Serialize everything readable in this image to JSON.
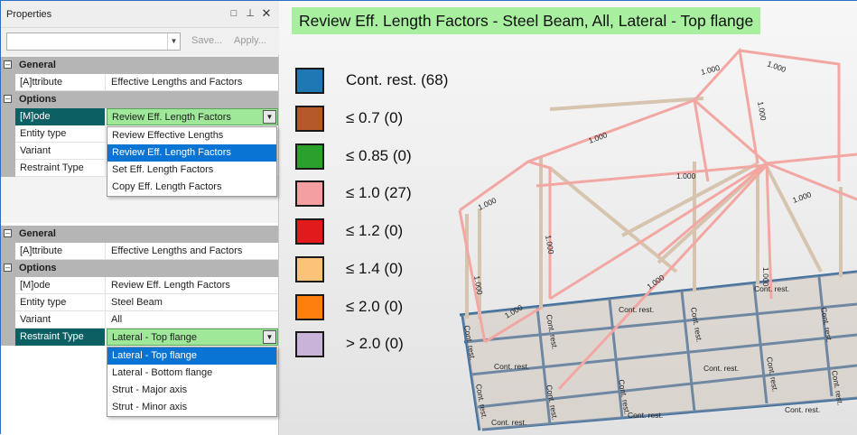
{
  "properties_top": {
    "title": "Properties",
    "toolbar": {
      "save_label": "Save...",
      "apply_label": "Apply..."
    },
    "categories": {
      "general": "General",
      "options": "Options"
    },
    "rows": [
      {
        "name": "[A]ttribute",
        "value": "Effective Lengths and Factors"
      },
      {
        "name": "[M]ode",
        "value": "Review Eff. Length Factors"
      },
      {
        "name": "Entity type",
        "value": ""
      },
      {
        "name": "Variant",
        "value": ""
      },
      {
        "name": "Restraint Type",
        "value": ""
      }
    ],
    "mode_dropdown": [
      "Review Effective Lengths",
      "Review Eff. Length Factors",
      "Set Eff. Length Factors",
      "Copy Eff. Length Factors"
    ]
  },
  "properties_bottom": {
    "categories": {
      "general": "General",
      "options": "Options"
    },
    "rows": [
      {
        "name": "[A]ttribute",
        "value": "Effective Lengths and Factors"
      },
      {
        "name": "[M]ode",
        "value": "Review Eff. Length Factors"
      },
      {
        "name": "Entity type",
        "value": "Steel Beam"
      },
      {
        "name": "Variant",
        "value": "All"
      },
      {
        "name": "Restraint Type",
        "value": "Lateral - Top flange"
      }
    ],
    "restraint_dropdown": [
      "Lateral - Top flange",
      "Lateral - Bottom flange",
      "Strut - Major axis",
      "Strut - Minor axis"
    ]
  },
  "view": {
    "title": "Review Eff. Length Factors - Steel Beam, All, Lateral - Top flange",
    "legend": [
      {
        "label": "Cont. rest. (68)",
        "color": "#1f77b4"
      },
      {
        "label": "≤ 0.7 (0)",
        "color": "#b5582a"
      },
      {
        "label": "≤ 0.85 (0)",
        "color": "#2ca02c"
      },
      {
        "label": "≤ 1.0 (27)",
        "color": "#f5a0a0"
      },
      {
        "label": "≤ 1.2 (0)",
        "color": "#e31a1c"
      },
      {
        "label": "≤ 1.4 (0)",
        "color": "#fdc27a"
      },
      {
        "label": "≤ 2.0 (0)",
        "color": "#ff7f0e"
      },
      {
        "label": "> 2.0 (0)",
        "color": "#c9b3d9"
      }
    ],
    "member_labels": {
      "factor": "1.000",
      "cont": "Cont. rest."
    }
  }
}
